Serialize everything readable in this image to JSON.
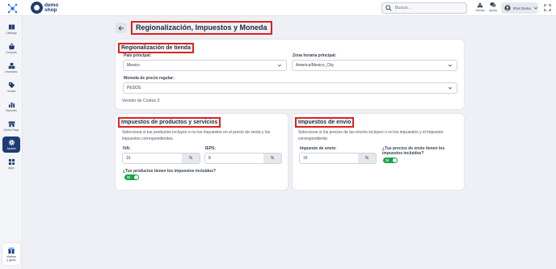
{
  "topbar": {
    "logo_top": "demo",
    "logo_bottom": "shop",
    "search_placeholder": "Buscar...",
    "alerts_label": "Alertas",
    "help_label": "Ayuda",
    "user_name": "iPos Demo"
  },
  "sidebar": {
    "items": [
      {
        "label": "Catálogo",
        "icon": "book-icon"
      },
      {
        "label": "Compras",
        "icon": "basket-icon"
      },
      {
        "label": "Inventario",
        "icon": "boxes-icon"
      },
      {
        "label": "Ventas",
        "icon": "tag-icon"
      },
      {
        "label": "Reportes",
        "icon": "bar-chart-icon"
      },
      {
        "label": "Online Shop",
        "icon": "store-icon"
      },
      {
        "label": "Ajustes",
        "icon": "gear-icon"
      },
      {
        "label": "Apps",
        "icon": "apps-icon"
      }
    ],
    "help_line1": "¡Refiere",
    "help_line2": "y gana!"
  },
  "page": {
    "title": "Regionalización, Impuestos y Moneda"
  },
  "regional": {
    "title": "Regionalización de tienda",
    "country_label": "País principal:",
    "country_value": "Mexico",
    "timezone_label": "Zona horaria principal:",
    "timezone_value": "America/Mexico_City",
    "currency_label": "Moneda de precio regular:",
    "currency_value": "PESOS",
    "version_text": "Versión de Costos 3"
  },
  "product_taxes": {
    "title": "Impuestos de productos y servicios",
    "description": "Selecciona si tus productos incluyen o no los impuestos en el precio de venta y los impuestos correspondientes.",
    "iva_label": "IVA:",
    "iva_value": "16",
    "ieps_label": "IEPS:",
    "ieps_value": "8",
    "percent_unit": "%",
    "included_question": "¿Tus productos tienen los impuestos incluidos?",
    "toggle_label": "Sí"
  },
  "shipping_taxes": {
    "title": "Impuestos de envío",
    "description": "Selecciona si los precios de tus envíos incluyen o no los impuestos y el impuesto correspondiente.",
    "tax_label": "Impuesto de envío:",
    "tax_value": "16",
    "percent_unit": "%",
    "included_question": "¿Tus precios de envío tienen los impuestos incluidos?",
    "toggle_label": "Sí"
  },
  "colors": {
    "primary": "#1f3b73",
    "highlight": "#e02020",
    "toggle_on": "#16a34a"
  }
}
